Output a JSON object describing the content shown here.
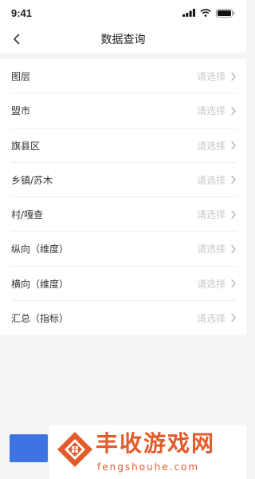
{
  "status": {
    "time": "9:41"
  },
  "nav": {
    "title": "数据查询"
  },
  "list": {
    "items": [
      {
        "label": "图层",
        "value": "请选择"
      },
      {
        "label": "盟市",
        "value": "请选择"
      },
      {
        "label": "旗县区",
        "value": "请选择"
      },
      {
        "label": "乡镇/苏木",
        "value": "请选择"
      },
      {
        "label": "村/嘎查",
        "value": "请选择"
      },
      {
        "label": "纵向（维度）",
        "value": "请选择"
      },
      {
        "label": "横向（维度）",
        "value": "请选择"
      },
      {
        "label": "汇总（指标）",
        "value": "请选择"
      }
    ]
  },
  "watermark": {
    "title": "丰收游戏网",
    "subtitle": "fengshouhe.com"
  },
  "colors": {
    "accent": "#3f73e2",
    "watermark": "#e25b2a",
    "placeholder": "#c6c8cc"
  },
  "icons": [
    "signal-icon",
    "wifi-icon",
    "battery-icon",
    "back-arrow-icon",
    "chevron-right-icon",
    "house-logo-icon"
  ]
}
